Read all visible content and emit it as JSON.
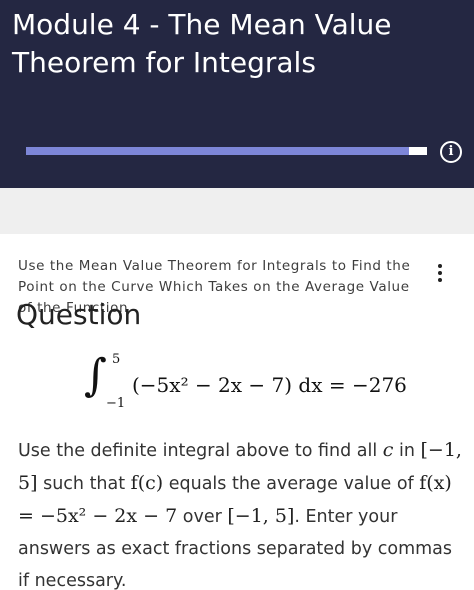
{
  "module": {
    "title": "Module 4 - The Mean Value Theorem for Integrals",
    "progress_fraction": 0.955,
    "info_icon": "info-icon"
  },
  "question": {
    "heading": "Use the Mean Value Theorem for Integrals to Find the Point on the Curve Which Takes on the Average Value of the Function",
    "label": "Question",
    "menu_icon": "kebab-menu-icon",
    "integral": {
      "upper": "5",
      "lower": "−1",
      "integrand": "(−5x² − 2x − 7) dx = −276"
    },
    "body": {
      "p1": "Use the definite integral above to find all ",
      "c": "c",
      "p2": " in ",
      "interval1": "[−1, 5]",
      "p3": " such that ",
      "fc": "f(c)",
      "p4": " equals the average value of ",
      "fx_def": "f(x) = −5x² − 2x − 7",
      "p5": " over ",
      "interval2": "[−1, 5]",
      "p6": ". Enter your answers as exact fractions separated by commas if necessary."
    }
  }
}
